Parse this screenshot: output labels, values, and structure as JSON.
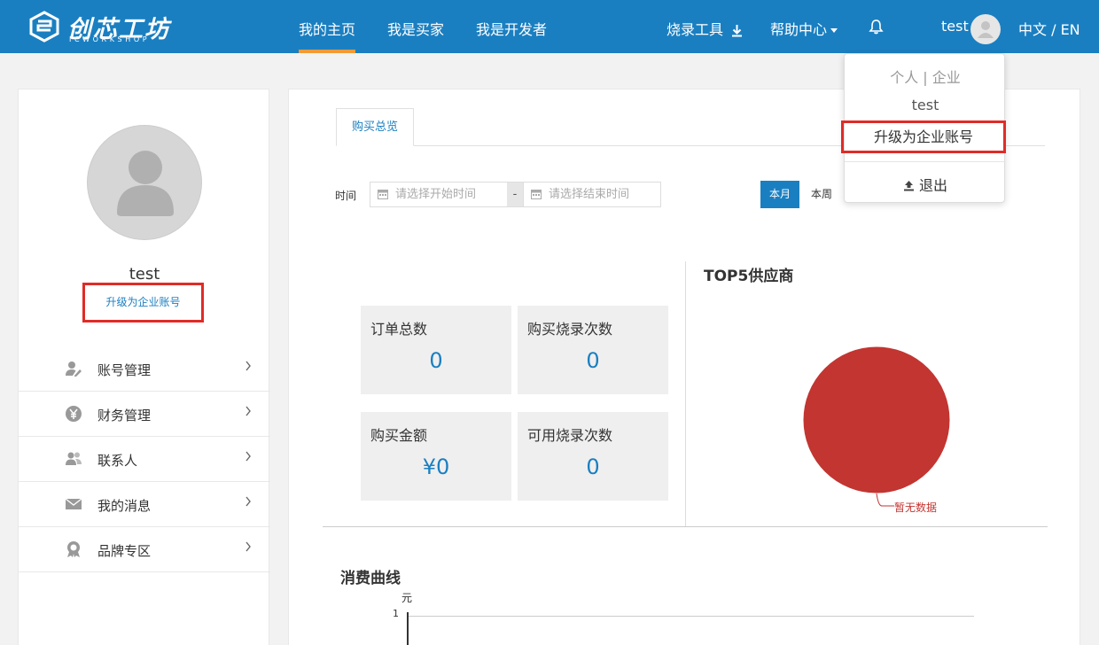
{
  "colors": {
    "brand": "#1a7fc1",
    "active_underline": "#f39a38",
    "highlight_box": "#e02b27",
    "pie_fill": "#c23531"
  },
  "header": {
    "logo_cn": "创芯工坊",
    "logo_en": "ICWORKSHOP",
    "nav": [
      {
        "label": "我的主页",
        "active": true
      },
      {
        "label": "我是买家",
        "active": false
      },
      {
        "label": "我是开发者",
        "active": false
      }
    ],
    "tools_label": "烧录工具",
    "help_label": "帮助中心",
    "bell_icon": "bell-icon",
    "username": "test",
    "language": "中文 / EN"
  },
  "dropdown": {
    "account_type": "个人 | 企业",
    "username": "test",
    "upgrade_label": "升级为企业账号",
    "logout_label": "退出"
  },
  "sidebar": {
    "username": "test",
    "upgrade_label": "升级为企业账号",
    "menu": [
      {
        "label": "账号管理",
        "icon": "user-edit-icon"
      },
      {
        "label": "财务管理",
        "icon": "yen-icon"
      },
      {
        "label": "联系人",
        "icon": "contacts-icon"
      },
      {
        "label": "我的消息",
        "icon": "envelope-icon"
      },
      {
        "label": "品牌专区",
        "icon": "badge-icon"
      }
    ]
  },
  "main": {
    "tab_label": "购买总览",
    "time_label": "时间",
    "start_placeholder": "请选择开始时间",
    "end_placeholder": "请选择结束时间",
    "date_separator": "-",
    "period_buttons": [
      {
        "label": "本月",
        "active": true
      },
      {
        "label": "本周",
        "active": false
      }
    ],
    "stats": [
      {
        "title": "订单总数",
        "value": "0"
      },
      {
        "title": "购买烧录次数",
        "value": "0"
      },
      {
        "title": "购买金额",
        "value": "¥0"
      },
      {
        "title": "可用烧录次数",
        "value": "0"
      }
    ],
    "top5_title": "TOP5供应商",
    "pie_label": "暂无数据",
    "curve_title": "消费曲线",
    "curve_unit": "元",
    "curve_tick": "1"
  }
}
